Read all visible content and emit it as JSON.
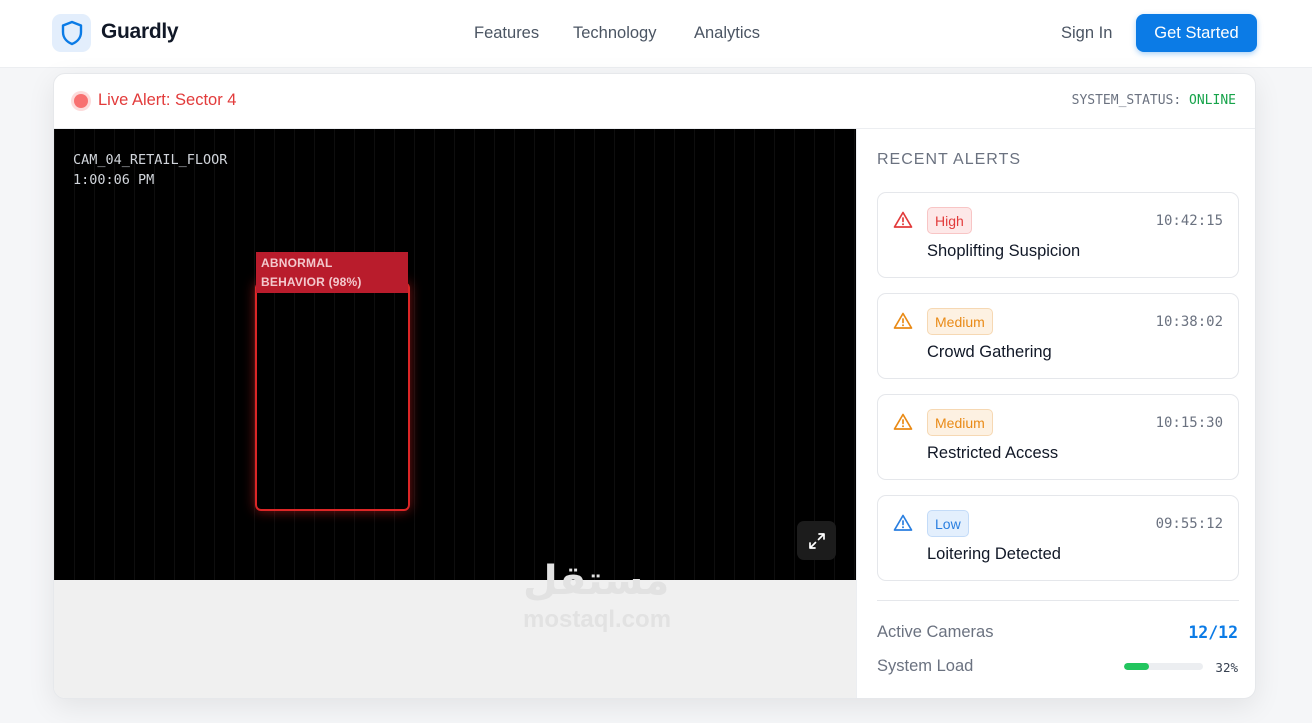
{
  "nav": {
    "brand": "Guardly",
    "links": [
      "Features",
      "Technology",
      "Analytics"
    ],
    "sign_in": "Sign In",
    "cta": "Get Started",
    "accent": "#0b7be6"
  },
  "live_panel": {
    "alert_title": "Live Alert: Sector 4",
    "status_key": "SYSTEM_STATUS:",
    "status_value": "ONLINE",
    "camera": {
      "name": "CAM_04_RETAIL_FLOOR",
      "time": "1:00:06 PM",
      "detection_label_line1": "ABNORMAL",
      "detection_label_line2": "BEHAVIOR (98%)",
      "expand_icon": "expand-icon"
    }
  },
  "sidebar": {
    "title": "RECENT ALERTS",
    "alerts": [
      {
        "severity": "High",
        "time": "10:42:15",
        "name": "Shoplifting Suspicion",
        "icon": "warning-triangle-icon",
        "color": "#e23b3b"
      },
      {
        "severity": "Medium",
        "time": "10:38:02",
        "name": "Crowd Gathering",
        "icon": "warning-triangle-icon",
        "color": "#e98a16"
      },
      {
        "severity": "Medium",
        "time": "10:15:30",
        "name": "Restricted Access",
        "icon": "warning-triangle-icon",
        "color": "#e98a16"
      },
      {
        "severity": "Low",
        "time": "09:55:12",
        "name": "Loitering Detected",
        "icon": "warning-triangle-icon",
        "color": "#2a7fe0"
      }
    ],
    "stats": {
      "active_cameras_label": "Active Cameras",
      "active_cameras_value": "12/12",
      "system_load_label": "System Load",
      "system_load_value": "32%",
      "system_load_fraction": 0.32
    }
  },
  "watermark": {
    "arabic": "مستقل",
    "latin": "mostaql.com"
  }
}
